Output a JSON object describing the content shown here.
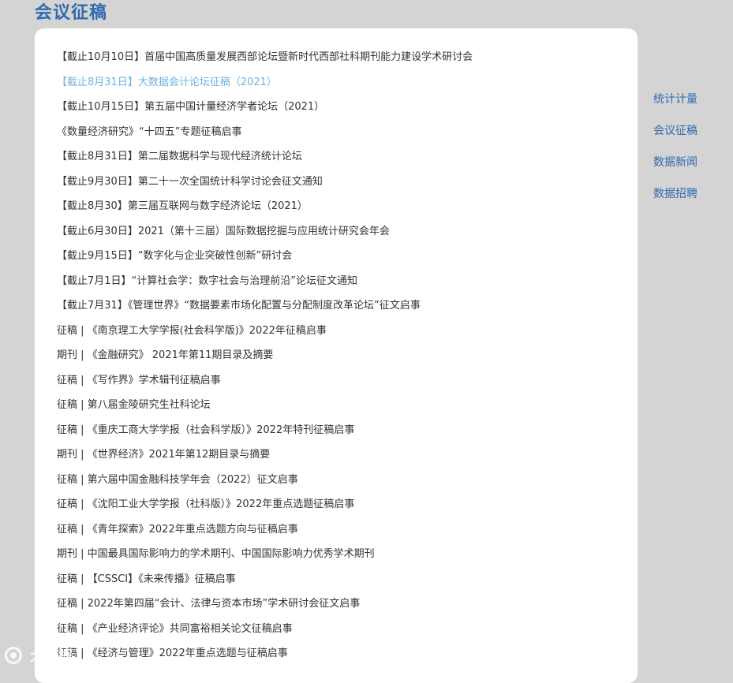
{
  "header": {
    "title": "会议征稿"
  },
  "list": {
    "items": [
      {
        "label": "【截止10月10日】首届中国高质量发展西部论坛暨新时代西部社科期刊能力建设学术研讨会"
      },
      {
        "label": "【截止8月31日】大数据会计论坛征稿（2021）",
        "active": true
      },
      {
        "label": "【截止10月15日】第五届中国计量经济学者论坛（2021）"
      },
      {
        "label": "《数量经济研究》“十四五”专题征稿启事"
      },
      {
        "label": "【截止8月31日】第二届数据科学与现代经济统计论坛"
      },
      {
        "label": "【截止9月30日】第二十一次全国统计科学讨论会征文通知"
      },
      {
        "label": "【截止8月30】第三届互联网与数字经济论坛（2021）"
      },
      {
        "label": "【截止6月30日】2021（第十三届）国际数据挖掘与应用统计研究会年会"
      },
      {
        "label": "【截止9月15日】“数字化与企业突破性创新”研讨会"
      },
      {
        "label": "【截止7月1日】“计算社会学：数字社会与治理前沿”论坛征文通知"
      },
      {
        "label": "【截止7月31】《管理世界》“数据要素市场化配置与分配制度改革论坛”征文启事"
      },
      {
        "label": "征稿 | 《南京理工大学学报(社会科学版)》2022年征稿启事"
      },
      {
        "label": "期刊 | 《金融研究》 2021年第11期目录及摘要"
      },
      {
        "label": "征稿 | 《写作界》学术辑刊征稿启事"
      },
      {
        "label": "征稿 | 第八届金陵研究生社科论坛"
      },
      {
        "label": "征稿 | 《重庆工商大学学报（社会科学版）》2022年特刊征稿启事"
      },
      {
        "label": "期刊 | 《世界经济》2021年第12期目录与摘要"
      },
      {
        "label": "征稿 | 第六届中国金融科技学年会（2022）征文启事"
      },
      {
        "label": "征稿 | 《沈阳工业大学学报（社科版）》2022年重点选题征稿启事"
      },
      {
        "label": "征稿 | 《青年探索》2022年重点选题方向与征稿启事"
      },
      {
        "label": "期刊 | 中国最具国际影响力的学术期刊、中国国际影响力优秀学术期刊"
      },
      {
        "label": "征稿 | 【CSSCI】《未来传播》征稿启事"
      },
      {
        "label": "征稿 | 2022年第四届“会计、法律与资本市场”学术研讨会征文启事"
      },
      {
        "label": "征稿 | 《产业经济评论》共同富裕相关论文征稿启事"
      },
      {
        "label": "征稿 | 《经济与管理》2022年重点选题与征稿启事"
      }
    ]
  },
  "side_nav": {
    "items": [
      {
        "label": "统计计量"
      },
      {
        "label": "会议征稿"
      },
      {
        "label": "数据新闻"
      },
      {
        "label": "数据招聘"
      }
    ]
  },
  "watermark": {
    "text": "大数据",
    "icon": "brand-logo-icon"
  },
  "colors": {
    "title": "#2f6bb0",
    "link_active": "#6fb3e0",
    "text": "#333333",
    "background": "#d4d4d4",
    "card": "#ffffff"
  }
}
